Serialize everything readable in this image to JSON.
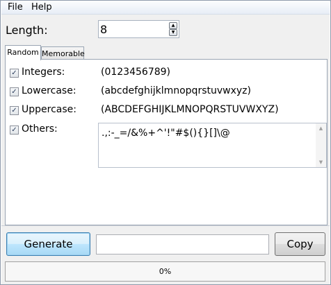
{
  "menu": {
    "file": "File",
    "help": "Help"
  },
  "length": {
    "label": "Length:",
    "value": "8"
  },
  "tabs": [
    {
      "label": "Random",
      "active": true
    },
    {
      "label": "Memorable",
      "active": false
    }
  ],
  "options": {
    "integers": {
      "label": "Integers:",
      "checked": true,
      "charset": "(0123456789)"
    },
    "lowercase": {
      "label": "Lowercase:",
      "checked": true,
      "charset": "(abcdefghijklmnopqrstuvwxyz)"
    },
    "uppercase": {
      "label": "Uppercase:",
      "checked": true,
      "charset": "(ABCDEFGHIJKLMNOPQRSTUVWXYZ)"
    },
    "others": {
      "label": "Others:",
      "checked": true,
      "value": ".,:-_=/&%+^'!\"#$(){}[]\\@"
    }
  },
  "actions": {
    "generate_label": "Generate",
    "copy_label": "Copy",
    "output_value": ""
  },
  "progress": {
    "fraction": 0,
    "text": "0%"
  },
  "icons": {
    "check": "checkmark-icon",
    "spin_up": "spin-up-icon",
    "spin_down": "spin-down-icon",
    "scroll_up": "scroll-up-icon",
    "scroll_down": "scroll-down-icon"
  }
}
